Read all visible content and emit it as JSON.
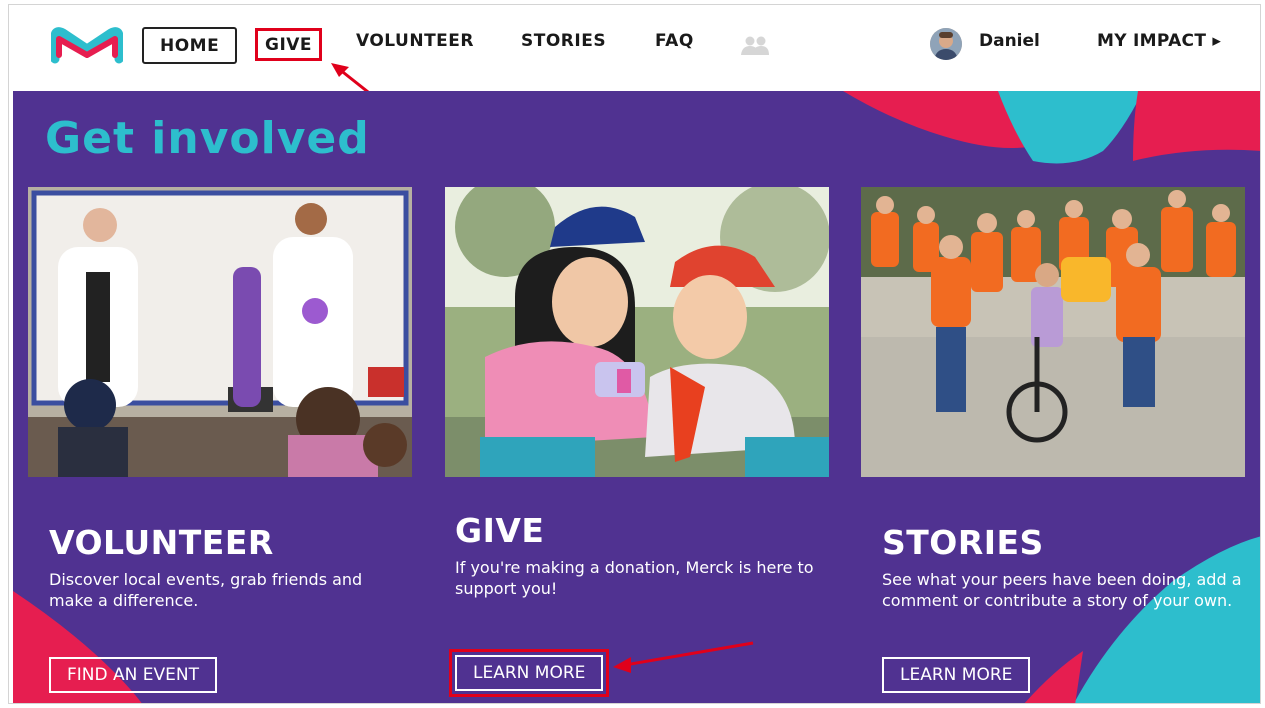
{
  "nav": {
    "home": "HOME",
    "give": "GIVE",
    "volunteer": "VOLUNTEER",
    "stories": "STORIES",
    "faq": "FAQ",
    "community_icon": "people-icon",
    "user_name": "Daniel",
    "my_impact": "MY IMPACT ▸"
  },
  "hero": {
    "heading": "Get involved"
  },
  "cards": [
    {
      "title": "VOLUNTEER",
      "text": "Discover local events, grab friends and make a difference.",
      "button": "FIND AN EVENT"
    },
    {
      "title": "GIVE",
      "text": "If you're making a donation, Merck is here to support you!",
      "button": "LEARN MORE"
    },
    {
      "title": "STORIES",
      "text": "See what your peers have been doing, add a comment or contribute a story of your own.",
      "button": "LEARN MORE"
    }
  ],
  "colors": {
    "brand_purple": "#503291",
    "brand_teal": "#2dbecd",
    "brand_red": "#e61e50",
    "annotation_red": "#e0001b"
  }
}
